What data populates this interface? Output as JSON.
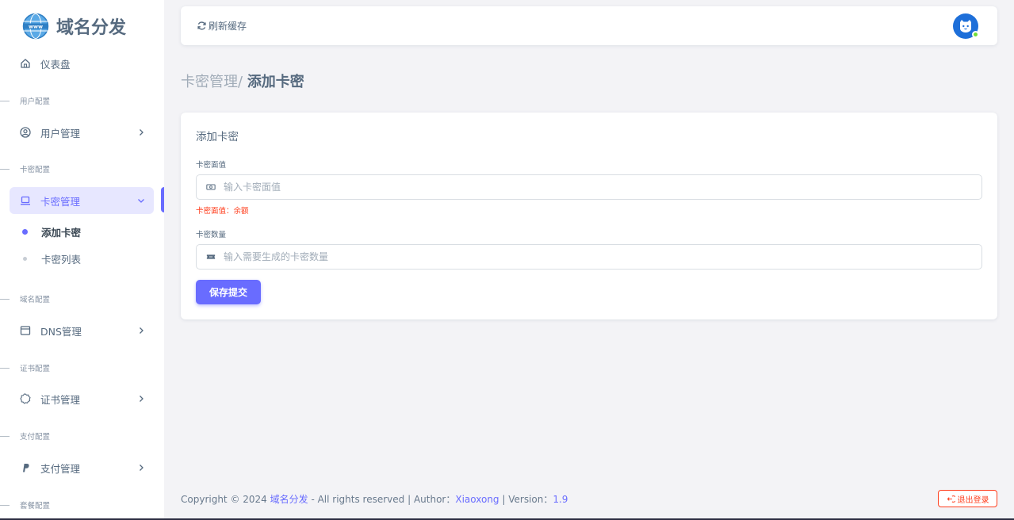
{
  "brand": {
    "name": "域名分发",
    "logo_icon": "globe-www-icon"
  },
  "sidebar": {
    "dashboard": {
      "label": "仪表盘",
      "icon": "home-icon"
    },
    "sections": {
      "user": "用户配置",
      "card": "卡密配置",
      "domain": "域名配置",
      "cert": "证书配置",
      "pay": "支付配置",
      "plan": "套餐配置"
    },
    "items": {
      "user_mgmt": {
        "label": "用户管理",
        "icon": "user-circle-icon"
      },
      "card_mgmt": {
        "label": "卡密管理",
        "icon": "laptop-icon"
      },
      "dns_mgmt": {
        "label": "DNS管理",
        "icon": "window-icon"
      },
      "cert_mgmt": {
        "label": "证书管理",
        "icon": "badge-icon"
      },
      "pay_mgmt": {
        "label": "支付管理",
        "icon": "paypal-icon"
      }
    },
    "subitems": {
      "add_card": "添加卡密",
      "card_list": "卡密列表"
    }
  },
  "navbar": {
    "refresh_label": "刷新缓存",
    "refresh_icon": "refresh-icon",
    "avatar_icon": "cat-avatar-icon"
  },
  "breadcrumb": {
    "parent": "卡密管理/",
    "current": "添加卡密"
  },
  "card": {
    "title": "添加卡密",
    "value_field": {
      "label": "卡密面值",
      "placeholder": "输入卡密面值",
      "help": "卡密面值：余额",
      "icon": "money-icon"
    },
    "count_field": {
      "label": "卡密数量",
      "placeholder": "输入需要生成的卡密数量",
      "icon": "ticket-icon"
    },
    "submit_label": "保存提交"
  },
  "footer": {
    "prefix": "Copyright © 2024 ",
    "site": "域名分发",
    "middle": " - All rights reserved | Author：",
    "author": "Xiaoxong",
    "version_prefix": " | Version：",
    "version": "1.9",
    "logout_label": "退出登录"
  },
  "colors": {
    "primary": "#696cff",
    "danger": "#ff3e1d",
    "online": "#71dd37"
  }
}
